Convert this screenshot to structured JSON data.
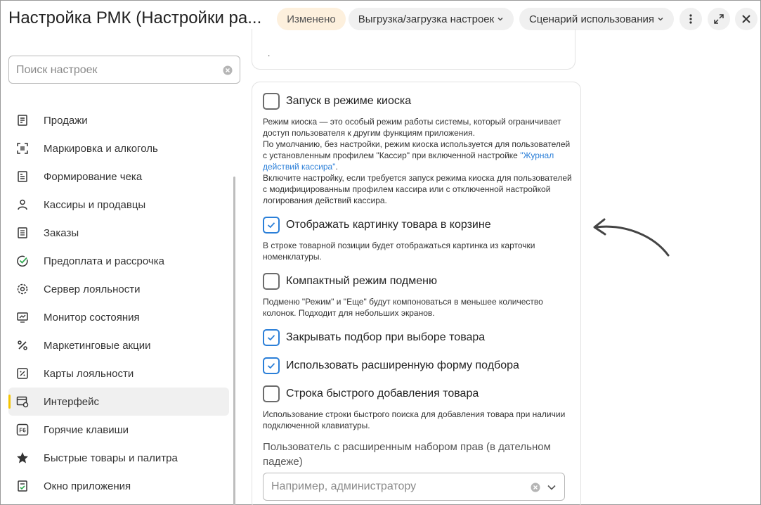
{
  "header": {
    "title": "Настройка РМК (Настройки ра...",
    "changed_badge": "Изменено",
    "upload_menu": "Выгрузка/загрузка настроек",
    "scenario_menu": "Сценарий использования"
  },
  "search": {
    "placeholder": "Поиск настроек"
  },
  "sidebar": {
    "items": [
      {
        "label": "Продажи",
        "icon": "receipt-register-icon"
      },
      {
        "label": "Маркировка и алкоголь",
        "icon": "qr-code-icon"
      },
      {
        "label": "Формирование чека",
        "icon": "receipt-icon"
      },
      {
        "label": "Кассиры и продавцы",
        "icon": "person-icon"
      },
      {
        "label": "Заказы",
        "icon": "document-icon"
      },
      {
        "label": "Предоплата и рассрочка",
        "icon": "check-circle-icon"
      },
      {
        "label": "Сервер лояльности",
        "icon": "gear-icon"
      },
      {
        "label": "Монитор состояния",
        "icon": "monitor-icon"
      },
      {
        "label": "Маркетинговые акции",
        "icon": "percent-icon"
      },
      {
        "label": "Карты лояльности",
        "icon": "discount-card-icon"
      },
      {
        "label": "Интерфейс",
        "icon": "interface-settings-icon",
        "active": true
      },
      {
        "label": "Горячие клавиши",
        "icon": "f6-key-icon"
      },
      {
        "label": "Быстрые товары и палитра",
        "icon": "star-icon"
      },
      {
        "label": "Окно приложения",
        "icon": "window-check-icon"
      }
    ]
  },
  "top_card": {
    "text": "."
  },
  "settings": {
    "kiosk": {
      "label": "Запуск в режиме киоска",
      "checked": false,
      "desc_1": "Режим киоска — это особый режим работы системы, который ограничивает доступ пользователя к другим функциям приложения.",
      "desc_2": "По умолчанию, без настройки, режим киоска используется для пользователей с установленным профилем \"Кассир\" при включенной настройке ",
      "desc_link": "\"Журнал действий кассира\"",
      "desc_3": ".",
      "desc_4": "Включите настройку, если требуется запуск режима киоска для пользователей с модифицированным профилем кассира или с отключенной настройкой логирования действий кассира."
    },
    "show_image": {
      "label": "Отображать картинку товара в корзине",
      "checked": true,
      "desc": "В строке товарной позиции будет отображаться картинка из карточки номенклатуры."
    },
    "compact_submenu": {
      "label": "Компактный режим подменю",
      "checked": false,
      "desc": "Подменю \"Режим\" и \"Еще\" будут компоноваться в меньшее количество колонок. Подходит для небольших экранов."
    },
    "close_picker": {
      "label": "Закрывать подбор при выборе товара",
      "checked": true
    },
    "extended_picker": {
      "label": "Использовать расширенную форму подбора",
      "checked": true
    },
    "quick_add": {
      "label": "Строка быстрого добавления товара",
      "checked": false,
      "desc": "Использование строки быстрого поиска для добавления товара при наличии подключенной клавиатуры."
    },
    "privileged_user": {
      "label": "Пользователь с расширенным набором прав (в дательном падеже)",
      "placeholder": "Например, администратору"
    }
  },
  "colors": {
    "accent": "#2b7fd8",
    "active_marker": "#f4c400",
    "changed_badge_bg": "#fdf0dd"
  }
}
